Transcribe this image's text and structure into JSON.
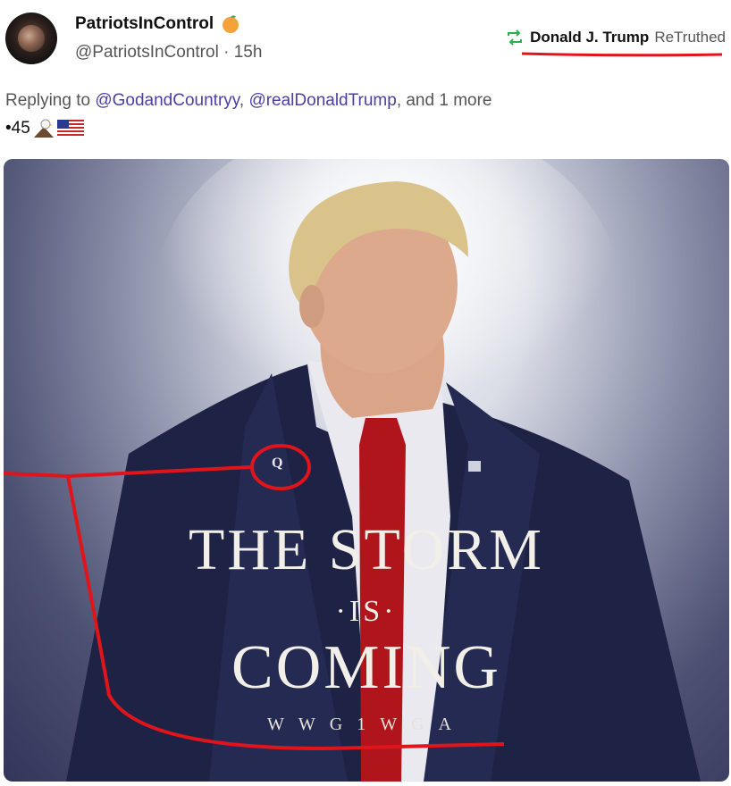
{
  "post": {
    "display_name": "PatriotsInControl",
    "handle": "@PatriotsInControl",
    "separator": "·",
    "age": "15h",
    "retruth_name": "Donald J. Trump",
    "retruth_label": "ReTruthed",
    "reply_prefix": "Replying to",
    "mention_1": "@GodandCountryy",
    "comma": ",",
    "mention_2": "@realDonaldTrump",
    "reply_suffix": ", and 1 more",
    "tag_text": "•45"
  },
  "media": {
    "badge": "Q",
    "line1": "THE STORM",
    "line2": "·IS·",
    "line3": "COMING",
    "line4": "WWG1WGA"
  },
  "colors": {
    "annotation_red": "#e0141b",
    "retruth_green": "#2bb24c",
    "mention_purple": "#4b3fa5"
  },
  "icons": {
    "verified": "orange-icon",
    "retruth": "retruth-icon",
    "eagle": "eagle-icon",
    "flag": "us-flag-icon"
  }
}
